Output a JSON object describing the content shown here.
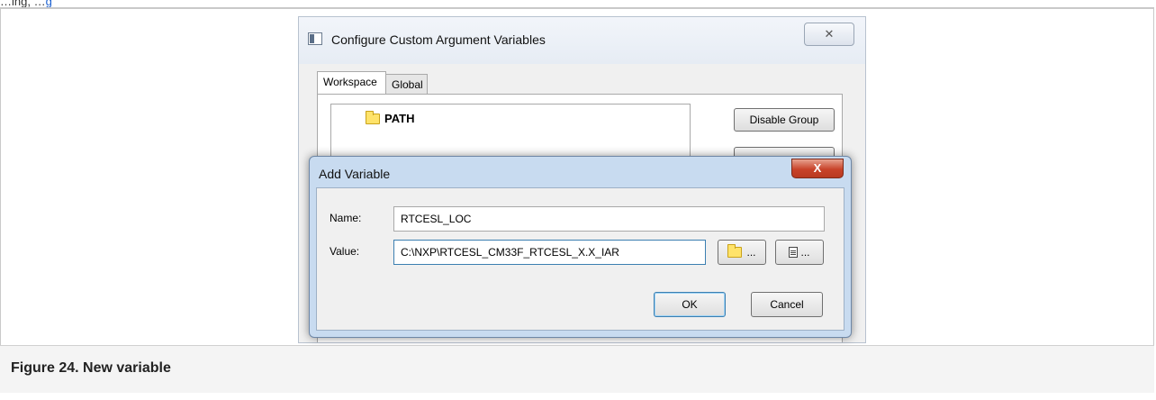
{
  "document": {
    "top_fragment": "…ing, …",
    "top_fragment_link": "g",
    "caption": "Figure 24.  New variable"
  },
  "main_window": {
    "title": "Configure Custom Argument Variables",
    "close_glyph": "✕",
    "tabs": [
      {
        "label": "Workspace",
        "active": true
      },
      {
        "label": "Global",
        "active": false
      }
    ],
    "tree": {
      "items": [
        {
          "label": "PATH",
          "icon": "folder-icon"
        }
      ]
    },
    "buttons": {
      "disable_group": "Disable Group"
    }
  },
  "add_variable_dialog": {
    "title": "Add Variable",
    "close_glyph": "X",
    "name_label": "Name:",
    "name_value": "RTCESL_LOC",
    "value_label": "Value:",
    "value_value": "C:\\NXP\\RTCESL_CM33F_RTCESL_X.X_IAR",
    "browse_folder_label": "...",
    "browse_file_label": "...",
    "ok_label": "OK",
    "cancel_label": "Cancel"
  },
  "colors": {
    "dialog_frame": "#c8dbf0",
    "close_red": "#c8432a",
    "folder_yellow": "#ffe36a",
    "focus_blue": "#3c7fb1"
  }
}
